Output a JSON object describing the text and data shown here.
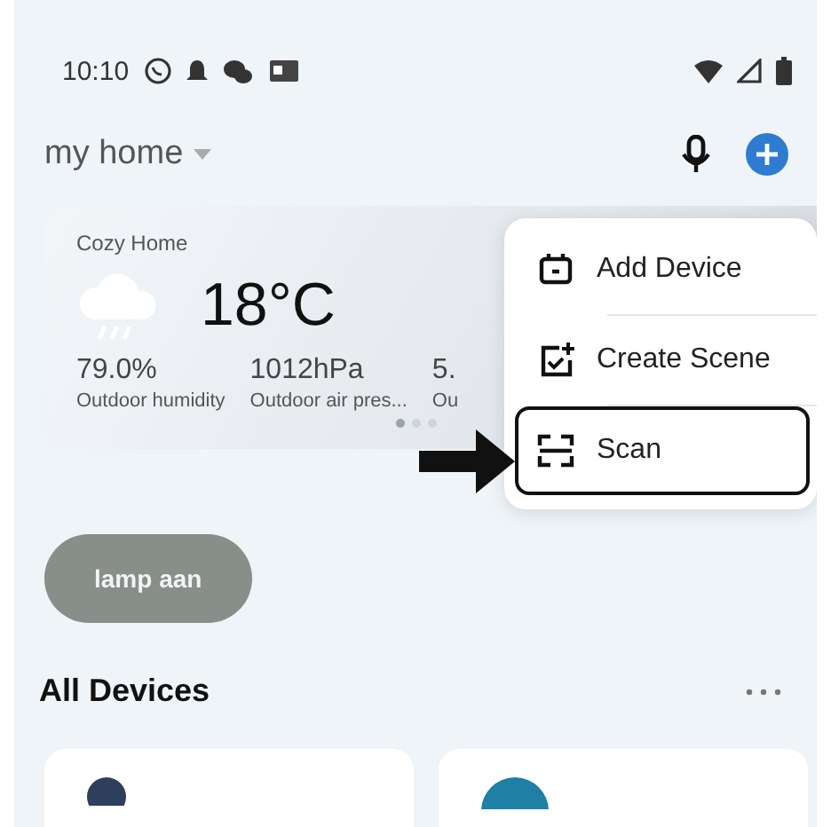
{
  "status_bar": {
    "time": "10:10"
  },
  "header": {
    "home_name": "my home"
  },
  "weather": {
    "title": "Cozy Home",
    "temperature": "18°C",
    "stats": [
      {
        "value": "79.0%",
        "label": "Outdoor humidity"
      },
      {
        "value": "1012hPa",
        "label": "Outdoor air pres..."
      },
      {
        "value": "5.",
        "label": "Ou"
      }
    ],
    "pages": [
      {
        "selected": true
      },
      {
        "selected": false
      },
      {
        "selected": false
      }
    ]
  },
  "menu": {
    "items": [
      {
        "kind": "device",
        "label": "Add Device",
        "highlighted": false
      },
      {
        "kind": "scene",
        "label": "Create Scene",
        "highlighted": false
      },
      {
        "kind": "scan",
        "label": "Scan",
        "highlighted": true
      }
    ]
  },
  "scenes": [
    {
      "label": "lamp aan"
    }
  ],
  "devices_section": {
    "title": "All Devices"
  }
}
